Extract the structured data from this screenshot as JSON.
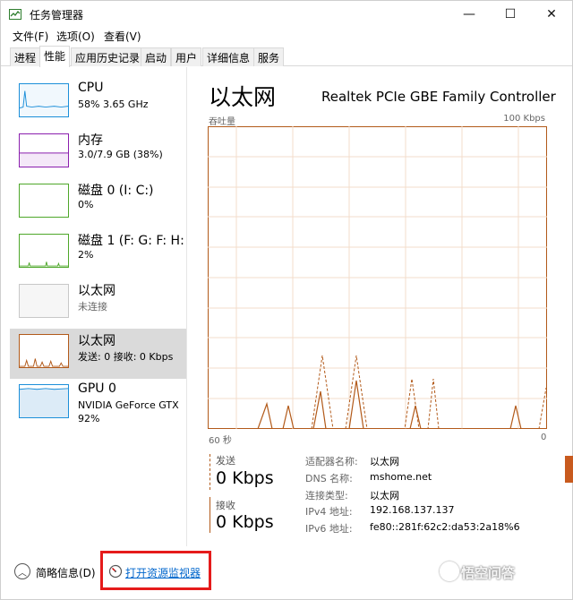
{
  "window": {
    "title": "任务管理器",
    "minimize": "—",
    "maximize": "☐",
    "close": "✕"
  },
  "menu": [
    "文件(F)",
    "选项(O)",
    "查看(V)"
  ],
  "tabs": [
    "进程",
    "性能",
    "应用历史记录",
    "启动",
    "用户",
    "详细信息",
    "服务"
  ],
  "active_tab": "性能",
  "sidebar": {
    "items": [
      {
        "name": "CPU",
        "sub": "58%  3.65 GHz",
        "sub2": "",
        "color": "#1c8fd9"
      },
      {
        "name": "内存",
        "sub": "3.0/7.9 GB (38%)",
        "sub2": "",
        "color": "#8b1fae"
      },
      {
        "name": "磁盘 0 (I: C:)",
        "sub": "0%",
        "sub2": "",
        "color": "#4ea72a"
      },
      {
        "name": "磁盘 1 (F: G: F: H:",
        "sub": "2%",
        "sub2": "",
        "color": "#4ea72a"
      },
      {
        "name": "以太网",
        "sub": "未连接",
        "sub2": "",
        "color": "#b8b8b8"
      },
      {
        "name": "以太网",
        "sub": "发送: 0 接收: 0 Kbps",
        "sub2": "",
        "color": "#b25a1a"
      },
      {
        "name": "GPU 0",
        "sub": "NVIDIA GeForce GTX",
        "sub2": "92%",
        "color": "#1c8fd9"
      }
    ]
  },
  "main": {
    "title": "以太网",
    "adapter": "Realtek PCIe GBE Family Controller",
    "axis_top_left": "吞吐量",
    "axis_top_right": "100 Kbps",
    "axis_bottom_left": "60 秒",
    "axis_bottom_right": "0",
    "graph_color": "#b25a1a"
  },
  "stats": {
    "send_label": "发送",
    "send_value": "0 Kbps",
    "recv_label": "接收",
    "recv_value": "0 Kbps"
  },
  "info": [
    {
      "key": "适配器名称:",
      "value": "以太网"
    },
    {
      "key": "DNS 名称:",
      "value": "mshome.net"
    },
    {
      "key": "连接类型:",
      "value": "以太网"
    },
    {
      "key": "IPv4 地址:",
      "value": "192.168.137.137"
    },
    {
      "key": "IPv6 地址:",
      "value": "fe80::281f:62c2:da53:2a18%6"
    }
  ],
  "bottom": {
    "brief_label": "简略信息(D)",
    "monitor_link": "打开资源监视器"
  },
  "watermark": "悟空问答"
}
